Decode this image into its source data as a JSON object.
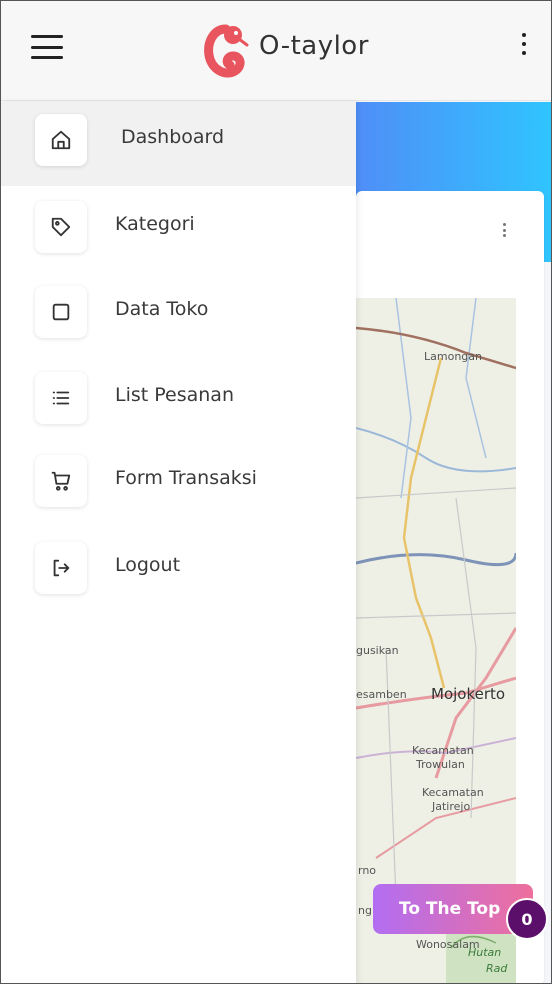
{
  "header": {
    "brand": "O-taylor",
    "logo_color": "#e8555f"
  },
  "sidebar": {
    "items": [
      {
        "label": "Dashboard",
        "icon": "home-icon",
        "active": true
      },
      {
        "label": "Kategori",
        "icon": "tag-icon",
        "active": false
      },
      {
        "label": "Data Toko",
        "icon": "square-icon",
        "active": false
      },
      {
        "label": "List Pesanan",
        "icon": "list-icon",
        "active": false
      },
      {
        "label": "Form Transaksi",
        "icon": "cart-icon",
        "active": false
      },
      {
        "label": "Logout",
        "icon": "logout-icon",
        "active": false
      }
    ]
  },
  "map": {
    "labels": {
      "lamongan": "Lamongan",
      "gusikan": "gusikan",
      "sesamben": "esamben",
      "mojokerto": "Mojokerto",
      "kec_trowulan_1": "Kecamatan",
      "kec_trowulan_2": "Trowulan",
      "kec_jatirejo_1": "Kecamatan",
      "kec_jatirejo_2": "Jatirejo",
      "rno": "rno",
      "ng": "ng",
      "wonosalam": "Wonosalam",
      "hutan": "Hutan",
      "rada": "Rad"
    }
  },
  "totop": {
    "label": "To The Top",
    "badge": "0"
  },
  "colors": {
    "accent_blue": "#2fc5ff",
    "totop_start": "#b26ef2",
    "totop_end": "#ee6f9c",
    "badge": "#5b0f6b"
  }
}
